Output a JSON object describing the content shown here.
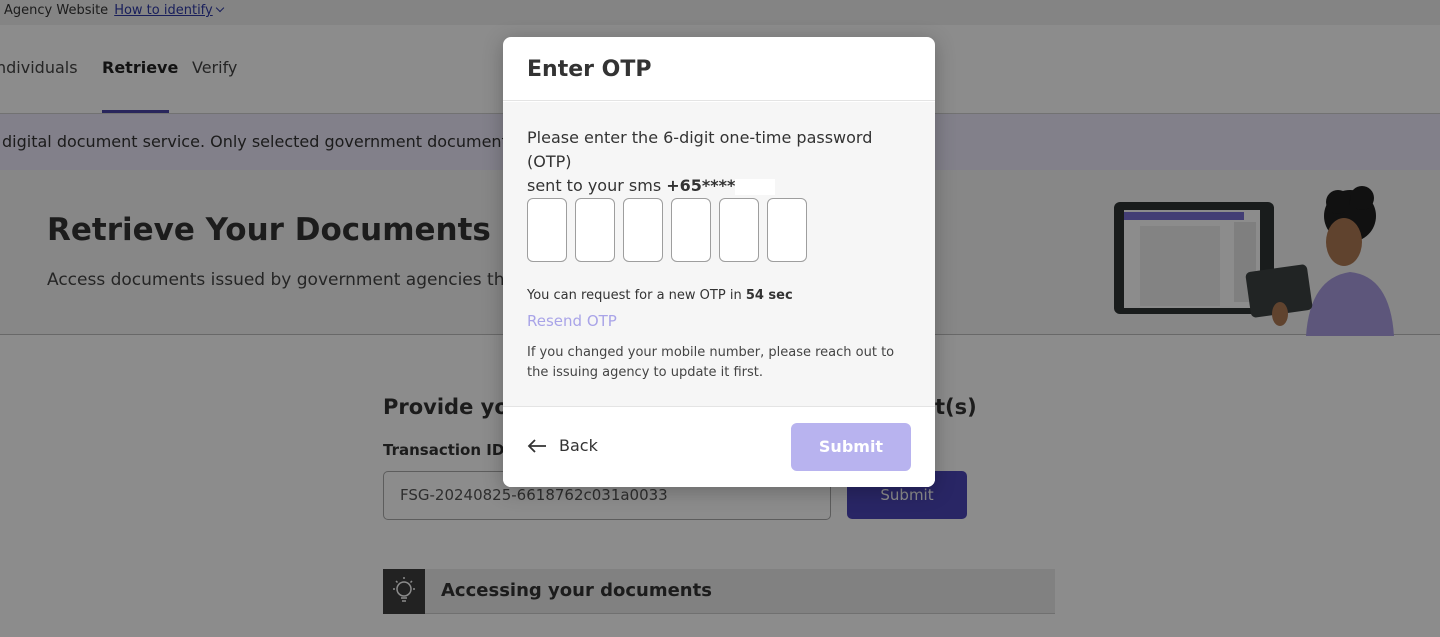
{
  "gov_bar": {
    "text": "Agency Website",
    "link": "How to identify"
  },
  "nav": {
    "tabs": [
      {
        "label": "ndividuals"
      },
      {
        "label": "Retrieve"
      },
      {
        "label": "Verify"
      }
    ]
  },
  "notice": {
    "text": "digital document service. Only selected government documents wi"
  },
  "hero": {
    "title": "Retrieve Your Documents",
    "subtitle": "Access documents issued by government agencies thr"
  },
  "form": {
    "title": "Provide you",
    "title_end": "t(s)",
    "tx_label": "Transaction ID",
    "tx_value": "FSG-20240825-6618762c031a0033",
    "submit_label": "Submit"
  },
  "access": {
    "label": "Accessing your documents",
    "icon": "lightbulb-icon"
  },
  "modal": {
    "title": "Enter OTP",
    "desc_line1": "Please enter the 6-digit one-time password (OTP)",
    "desc_line2_prefix": "sent to your sms ",
    "phone_masked": "+65****",
    "otp_count": 6,
    "countdown_prefix": "You can request for a new OTP in ",
    "countdown_value": "54 sec",
    "resend_label": "Resend OTP",
    "hint": "If you changed your mobile number, please reach out to the issuing agency to update it first.",
    "back_label": "Back",
    "back_icon": "arrow-left-icon",
    "submit_label": "Submit",
    "colors": {
      "submit_disabled": "#b8b3ef",
      "resend": "#a9a4e8",
      "accent": "#4b46b8"
    }
  }
}
